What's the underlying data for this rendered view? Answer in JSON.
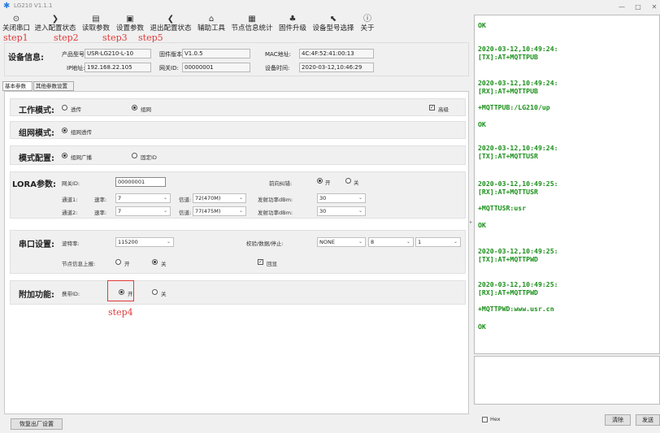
{
  "window": {
    "title": "LG210 V1.1.1",
    "min": "—",
    "max": "□",
    "close": "✕"
  },
  "toolbar": [
    {
      "label": "关闭串口",
      "icon": "⊙"
    },
    {
      "label": "进入配置状态",
      "icon": "❯"
    },
    {
      "label": "读取参数",
      "icon": "▤"
    },
    {
      "label": "设置参数",
      "icon": "▣"
    },
    {
      "label": "退出配置状态",
      "icon": "❮"
    },
    {
      "label": "辅助工具",
      "icon": "⌂"
    },
    {
      "label": "节点信息统计",
      "icon": "▦"
    },
    {
      "label": "固件升级",
      "icon": "♣"
    },
    {
      "label": "设备型号选择",
      "icon": "⬉"
    },
    {
      "label": "关于",
      "icon": "ⓘ"
    }
  ],
  "steps": [
    "step1",
    "step2",
    "step3",
    "step5",
    "step4"
  ],
  "device": {
    "label": "设备信息:",
    "model_label": "产品型号:",
    "model": "USR-LG210-L-10",
    "fw_label": "固件版本:",
    "fw": "V1.0.5",
    "mac_label": "MAC地址:",
    "mac": "4C:4F:52:41:00:13",
    "ip_label": "IP地址:",
    "ip": "192.168.22.105",
    "gw_label": "网关ID:",
    "gw": "00000001",
    "time_label": "设备时间:",
    "time": "2020-03-12,10:46:29"
  },
  "tabs": [
    "基本参数",
    "其他参数设置"
  ],
  "work": {
    "label": "工作模式:",
    "opt1": "透传",
    "opt2": "组网",
    "adv": "高级"
  },
  "net": {
    "label": "组网模式:",
    "opt1": "组网透传"
  },
  "mode": {
    "label": "模式配置:",
    "opt1": "组网广播",
    "opt2": "固定ID"
  },
  "lora": {
    "label": "LORA参数:",
    "gw_label": "网关ID:",
    "gw": "00000001",
    "fec_label": "前向纠错:",
    "on": "开",
    "off": "关",
    "ch1": "通道1:",
    "ch2": "通道2:",
    "rate": "速率:",
    "rate1": "7",
    "rate2": "7",
    "sig": "信道:",
    "sig1": "72(470M)",
    "sig2": "77(475M)",
    "pw": "发射功率dBm:",
    "pw1": "30",
    "pw2": "30"
  },
  "serial": {
    "label": "串口设置:",
    "baud_label": "波特率:",
    "baud": "115200",
    "parity_label": "校验/数据/停止:",
    "parity": "NONE",
    "data": "8",
    "stop": "1",
    "report_label": "节点信息上报:",
    "on": "开",
    "off": "关",
    "echo": "回显"
  },
  "extra": {
    "label": "附加功能:",
    "id_label": "携带ID:",
    "on": "开",
    "off": "关"
  },
  "reset": "恢复出厂设置",
  "log": [
    "OK",
    "2020-03-12,10:49:24:",
    "[TX]:AT+MQTTPUB",
    "2020-03-12,10:49:24:",
    "[RX]:AT+MQTTPUB",
    "+MQTTPUB:/LG210/up",
    "OK",
    "2020-03-12,10:49:24:",
    "[TX]:AT+MQTTUSR",
    "2020-03-12,10:49:25:",
    "[RX]:AT+MQTTUSR",
    "+MQTTUSR:usr",
    "OK",
    "2020-03-12,10:49:25:",
    "[TX]:AT+MQTTPWD",
    "2020-03-12,10:49:25:",
    "[RX]:AT+MQTTPWD",
    "+MQTTPWD:www.usr.cn",
    "OK"
  ],
  "bottom": {
    "hex": "Hex",
    "clear": "清除",
    "send": "发送"
  }
}
